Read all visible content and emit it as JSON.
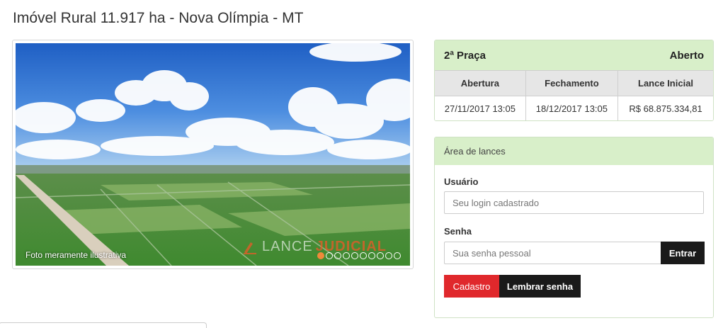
{
  "page": {
    "title": "Imóvel Rural 11.917 ha - Nova Olímpia - MT"
  },
  "photo": {
    "caption": "Foto meramente ilustrativa",
    "watermark_a": "LANCE",
    "watermark_b": "JUDICIAL",
    "slide_count": 10,
    "active_slide": 1
  },
  "status": {
    "round": "2ª Praça",
    "state": "Aberto",
    "headers": [
      "Abertura",
      "Fechamento",
      "Lance Inicial"
    ],
    "values": [
      "27/11/2017 13:05",
      "18/12/2017 13:05",
      "R$ 68.875.334,81"
    ]
  },
  "bidding": {
    "title": "Área de lances",
    "user_label": "Usuário",
    "user_placeholder": "Seu login cadastrado",
    "pass_label": "Senha",
    "pass_placeholder": "Sua senha pessoal",
    "enter_label": "Entrar",
    "signup_label": "Cadastro",
    "remember_label": "Lembrar senha"
  },
  "colors": {
    "panel_header": "#d8efc9",
    "danger": "#e0282c",
    "dark": "#1a1a1a",
    "active_dot": "#f08a3a"
  }
}
